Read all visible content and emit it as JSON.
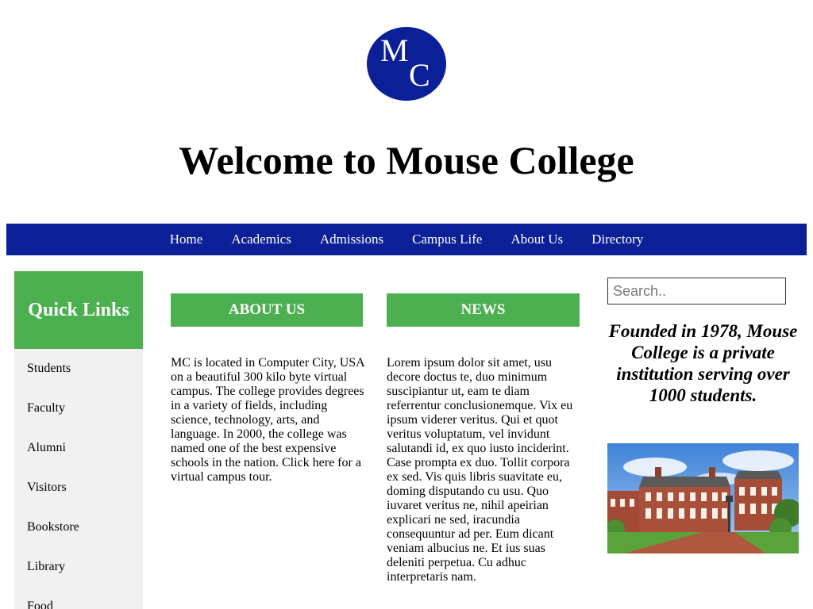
{
  "logo": {
    "letter1": "M",
    "letter2": "C"
  },
  "page": {
    "title": "Welcome to Mouse College"
  },
  "nav": {
    "items": [
      {
        "label": "Home"
      },
      {
        "label": "Academics"
      },
      {
        "label": "Admissions"
      },
      {
        "label": "Campus Life"
      },
      {
        "label": "About Us"
      },
      {
        "label": "Directory"
      }
    ]
  },
  "sidebar": {
    "heading": "Quick Links",
    "links": [
      {
        "label": "Students"
      },
      {
        "label": "Faculty"
      },
      {
        "label": "Alumni"
      },
      {
        "label": "Visitors"
      },
      {
        "label": "Bookstore"
      },
      {
        "label": "Library"
      },
      {
        "label": "Food"
      }
    ]
  },
  "about": {
    "heading": "ABOUT US",
    "body": "MC is located in Computer City, USA on a beautiful 300 kilo byte virtual campus. The college provides degrees in a variety of fields, including science, technology, arts, and language. In 2000, the college was named one of the best expensive schools in the nation. Click here for a virtual campus tour."
  },
  "news": {
    "heading": "NEWS",
    "body": "Lorem ipsum dolor sit amet, usu decore doctus te, duo minimum suscipiantur ut, eam te diam referrentur conclusionemque. Vix eu ipsum viderer veritus. Qui et quot veritus voluptatum, vel invidunt salutandi id, ex quo iusto inciderint. Case prompta ex duo. Tollit corpora ex sed. Vis quis libris suavitate eu, doming disputando cu usu. Quo iuvaret veritus ne, nihil apeirian explicari ne sed, iracundia consequuntur ad per. Eum dicant veniam albucius ne. Et ius suas deleniti perpetua. Cu adhuc interpretaris nam."
  },
  "search": {
    "placeholder": "Search.."
  },
  "founded": {
    "text": "Founded in 1978, Mouse College is a private institution serving over 1000 students."
  },
  "colors": {
    "brand_blue": "#0b1f96",
    "accent_green": "#4caf50",
    "sidebar_bg": "#f1f1f1"
  }
}
